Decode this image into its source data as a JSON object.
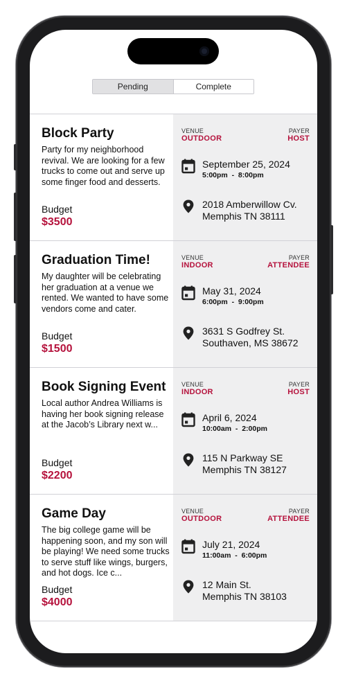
{
  "tabs": {
    "pending": "Pending",
    "complete": "Complete"
  },
  "labels": {
    "venue": "VENUE",
    "payer": "PAYER",
    "budget": "Budget"
  },
  "icons": {
    "date": "calendar-icon",
    "location": "location-pin-icon"
  },
  "colors": {
    "accent": "#b5123c",
    "panel": "#efeff0"
  },
  "events": [
    {
      "title": "Block Party",
      "description": "Party for my neighborhood revival. We are looking for a few trucks to come out and serve up some finger food and desserts.",
      "budget": "$3500",
      "venue": "OUTDOOR",
      "payer": "HOST",
      "date": "September 25, 2024",
      "time": "5:00pm  -  8:00pm",
      "address_line1": "2018 Amberwillow Cv.",
      "address_line2": "Memphis TN 38111"
    },
    {
      "title": "Graduation Time!",
      "description": "My daughter will be celebrating her graduation at a venue we rented. We wanted to have some vendors come and cater.",
      "budget": "$1500",
      "venue": "INDOOR",
      "payer": "ATTENDEE",
      "date": "May 31, 2024",
      "time": "6:00pm  -  9:00pm",
      "address_line1": "3631 S Godfrey St.",
      "address_line2": "Southaven, MS 38672"
    },
    {
      "title": "Book Signing Event",
      "description": "Local author Andrea Williams is having her book signing release at the Jacob’s Library next w...",
      "budget": "$2200",
      "venue": "INDOOR",
      "payer": "HOST",
      "date": "April 6, 2024",
      "time": "10:00am  -  2:00pm",
      "address_line1": "115 N Parkway SE",
      "address_line2": "Memphis TN 38127"
    },
    {
      "title": "Game Day",
      "description": "The big college game will be happening soon, and my son will be playing! We need some trucks to serve stuff like wings, burgers, and hot dogs. Ice c...",
      "budget": "$4000",
      "venue": "OUTDOOR",
      "payer": "ATTENDEE",
      "date": "July 21, 2024",
      "time": "11:00am  -  6:00pm",
      "address_line1": "12 Main St.",
      "address_line2": "Memphis TN 38103"
    }
  ]
}
